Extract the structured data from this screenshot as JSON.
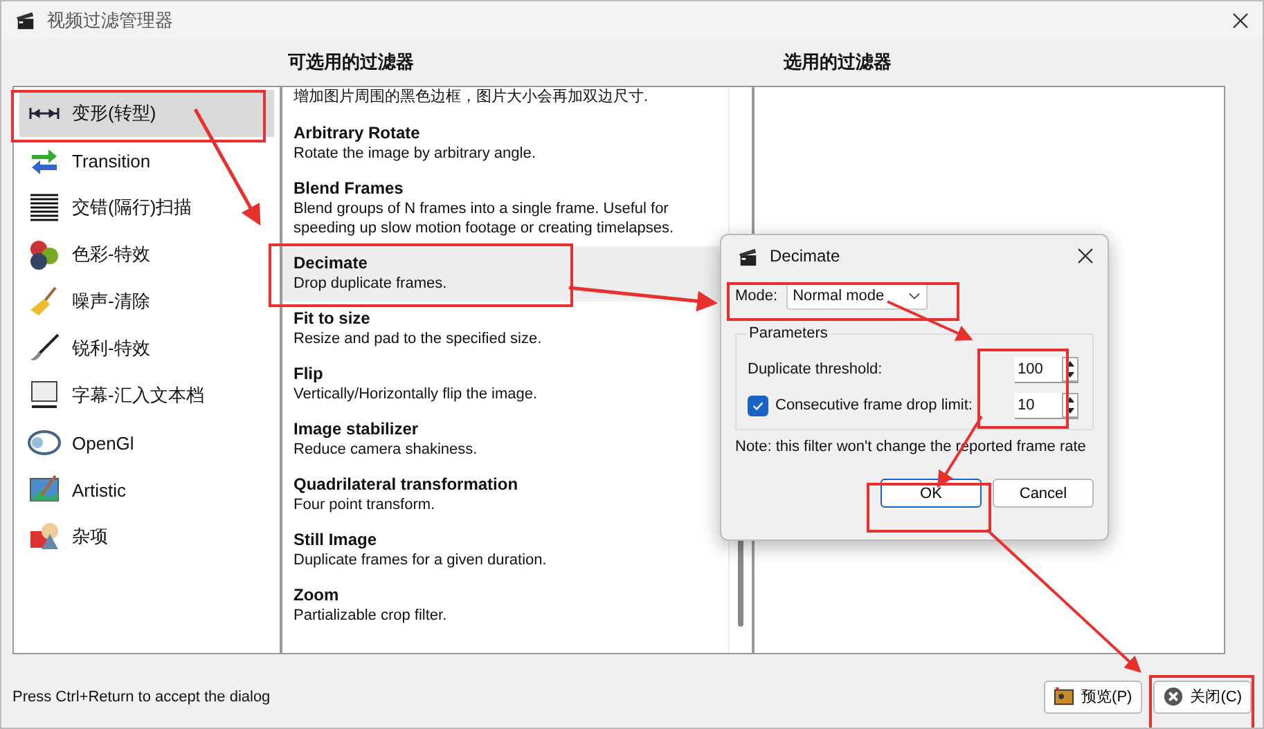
{
  "window": {
    "title": "视频过滤管理器"
  },
  "categories": [
    {
      "label": "变形(转型)",
      "selected": true
    },
    {
      "label": "Transition",
      "selected": false
    },
    {
      "label": "交错(隔行)扫描",
      "selected": false
    },
    {
      "label": "色彩-特效",
      "selected": false
    },
    {
      "label": "噪声-清除",
      "selected": false
    },
    {
      "label": "锐利-特效",
      "selected": false
    },
    {
      "label": "字幕-汇入文本档",
      "selected": false
    },
    {
      "label": "OpenGl",
      "selected": false
    },
    {
      "label": "Artistic",
      "selected": false
    },
    {
      "label": "杂项",
      "selected": false
    }
  ],
  "available": {
    "heading": "可选用的过滤器",
    "partial_line": "增加图片周围的黑色边框，图片大小会再加双边尺寸.",
    "filters": [
      {
        "name": "Arbitrary Rotate",
        "description": "Rotate the image by arbitrary angle.",
        "selected": false
      },
      {
        "name": "Blend Frames",
        "description": "Blend groups of N frames into a single frame.  Useful for speeding up slow motion footage or creating timelapses.",
        "selected": false
      },
      {
        "name": "Decimate",
        "description": "Drop duplicate frames.",
        "selected": true
      },
      {
        "name": "Fit to size",
        "description": "Resize and pad to the specified size.",
        "selected": false
      },
      {
        "name": "Flip",
        "description": "Vertically/Horizontally flip the image.",
        "selected": false
      },
      {
        "name": "Image stabilizer",
        "description": "Reduce camera shakiness.",
        "selected": false
      },
      {
        "name": "Quadrilateral transformation",
        "description": "Four point transform.",
        "selected": false
      },
      {
        "name": "Still Image",
        "description": "Duplicate frames for a given duration.",
        "selected": false
      },
      {
        "name": "Zoom",
        "description": "Partializable crop filter.",
        "selected": false
      }
    ]
  },
  "active": {
    "heading": "选用的过滤器"
  },
  "status": "Press Ctrl+Return to accept the dialog",
  "buttons": [
    {
      "label": "预览(P)",
      "kind": "preview"
    },
    {
      "label": "关闭(C)",
      "kind": "close"
    }
  ],
  "dialog": {
    "title": "Decimate",
    "mode_label": "Mode:",
    "mode_value": "Normal mode",
    "group": "Parameters",
    "threshold_label": "Duplicate threshold:",
    "threshold_value": "100",
    "drop_limit_label": "Consecutive frame drop limit:",
    "drop_limit_checked": true,
    "drop_limit_value": "10",
    "note": "Note: this filter won't change the reported frame rate",
    "buttons": [
      {
        "label": "OK",
        "default": true
      },
      {
        "label": "Cancel",
        "default": false
      }
    ]
  }
}
